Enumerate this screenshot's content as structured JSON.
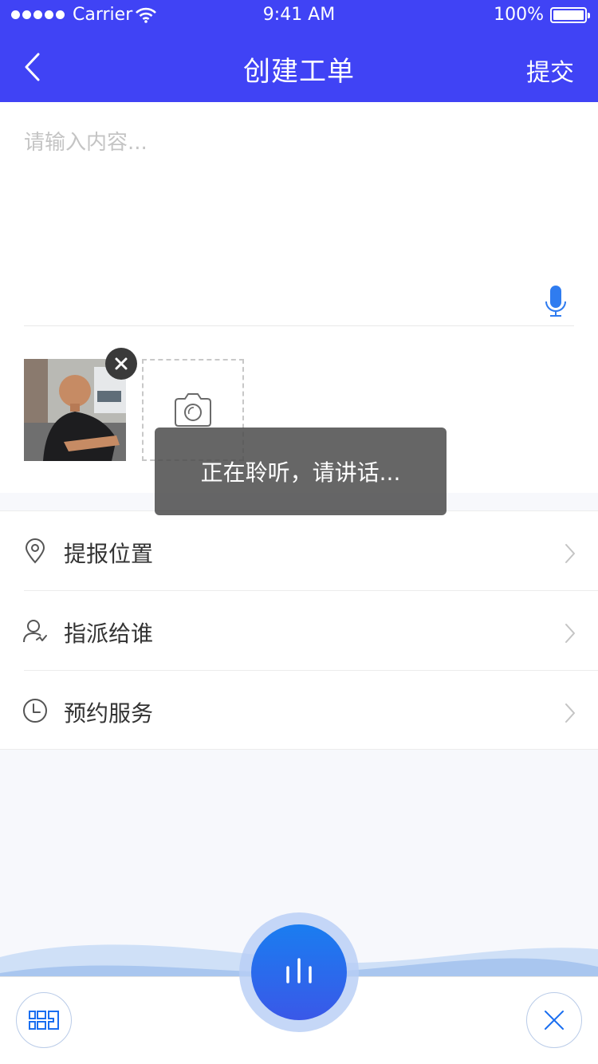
{
  "status_bar": {
    "carrier": "Carrier",
    "time": "9:41 AM",
    "battery": "100%"
  },
  "nav": {
    "title": "创建工单",
    "submit": "提交"
  },
  "content": {
    "placeholder": "请输入内容..."
  },
  "toast": {
    "text": "正在聆听，请讲话..."
  },
  "menu": {
    "items": [
      {
        "label": "提报位置",
        "icon": "location-pin-icon"
      },
      {
        "label": "指派给谁",
        "icon": "user-assign-icon"
      },
      {
        "label": "预约服务",
        "icon": "clock-icon"
      }
    ]
  },
  "colors": {
    "header": "#4043f5",
    "accent": "#1a6ef0",
    "toast_bg": "#4b4b4b"
  }
}
